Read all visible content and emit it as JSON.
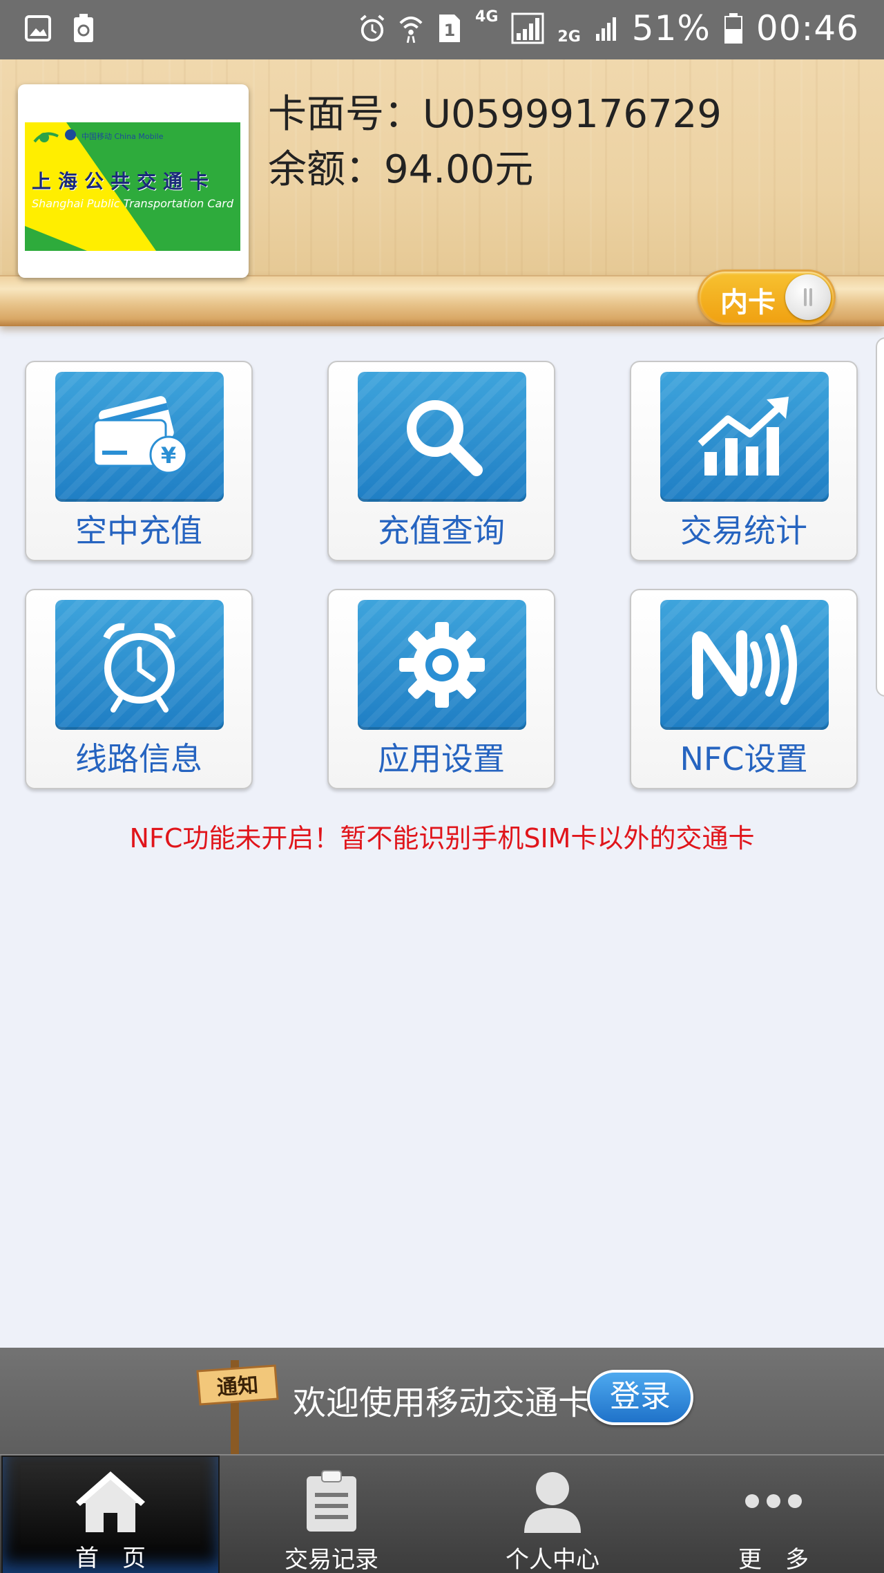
{
  "status_bar": {
    "network_4g": "4G",
    "network_2g": "2G",
    "sim_slot": "1",
    "battery": "51%",
    "time": "00:46",
    "icons": [
      "gallery-icon",
      "recycle-icon",
      "alarm-icon",
      "wifi-icon",
      "sim-icon",
      "signal-icon",
      "battery-icon"
    ]
  },
  "card": {
    "title": "上海公共交通卡",
    "subtitle": "Shanghai Public Transportation Card",
    "logo_text": "中国移动 China Mobile",
    "number_label": "卡面号：U05999176729",
    "balance_label": "余额：94.00元",
    "toggle_label": "内卡"
  },
  "menu": {
    "items": [
      {
        "label": "空中充值",
        "icon": "card-yen-icon"
      },
      {
        "label": "充值查询",
        "icon": "magnifier-icon"
      },
      {
        "label": "交易统计",
        "icon": "chart-trend-icon"
      },
      {
        "label": "线路信息",
        "icon": "alarm-clock-icon"
      },
      {
        "label": "应用设置",
        "icon": "gear-icon"
      },
      {
        "label": "NFC设置",
        "icon": "nfc-icon"
      }
    ]
  },
  "nfc_warning": "NFC功能未开启！暂不能识别手机SIM卡以外的交通卡",
  "notice": {
    "sign_label": "通知",
    "text": "欢迎使用移动交通卡",
    "login_button": "登录"
  },
  "bottom_nav": {
    "items": [
      {
        "label": "首　页",
        "icon": "home-icon",
        "active": true
      },
      {
        "label": "交易记录",
        "icon": "clipboard-icon",
        "active": false
      },
      {
        "label": "个人中心",
        "icon": "person-icon",
        "active": false
      },
      {
        "label": "更　多",
        "icon": "more-dots-icon",
        "active": false
      }
    ]
  },
  "colors": {
    "tile_blue": "#2a8fd4",
    "label_blue": "#2664c0",
    "warning_red": "#e0151b",
    "toggle_orange": "#f4b020"
  }
}
